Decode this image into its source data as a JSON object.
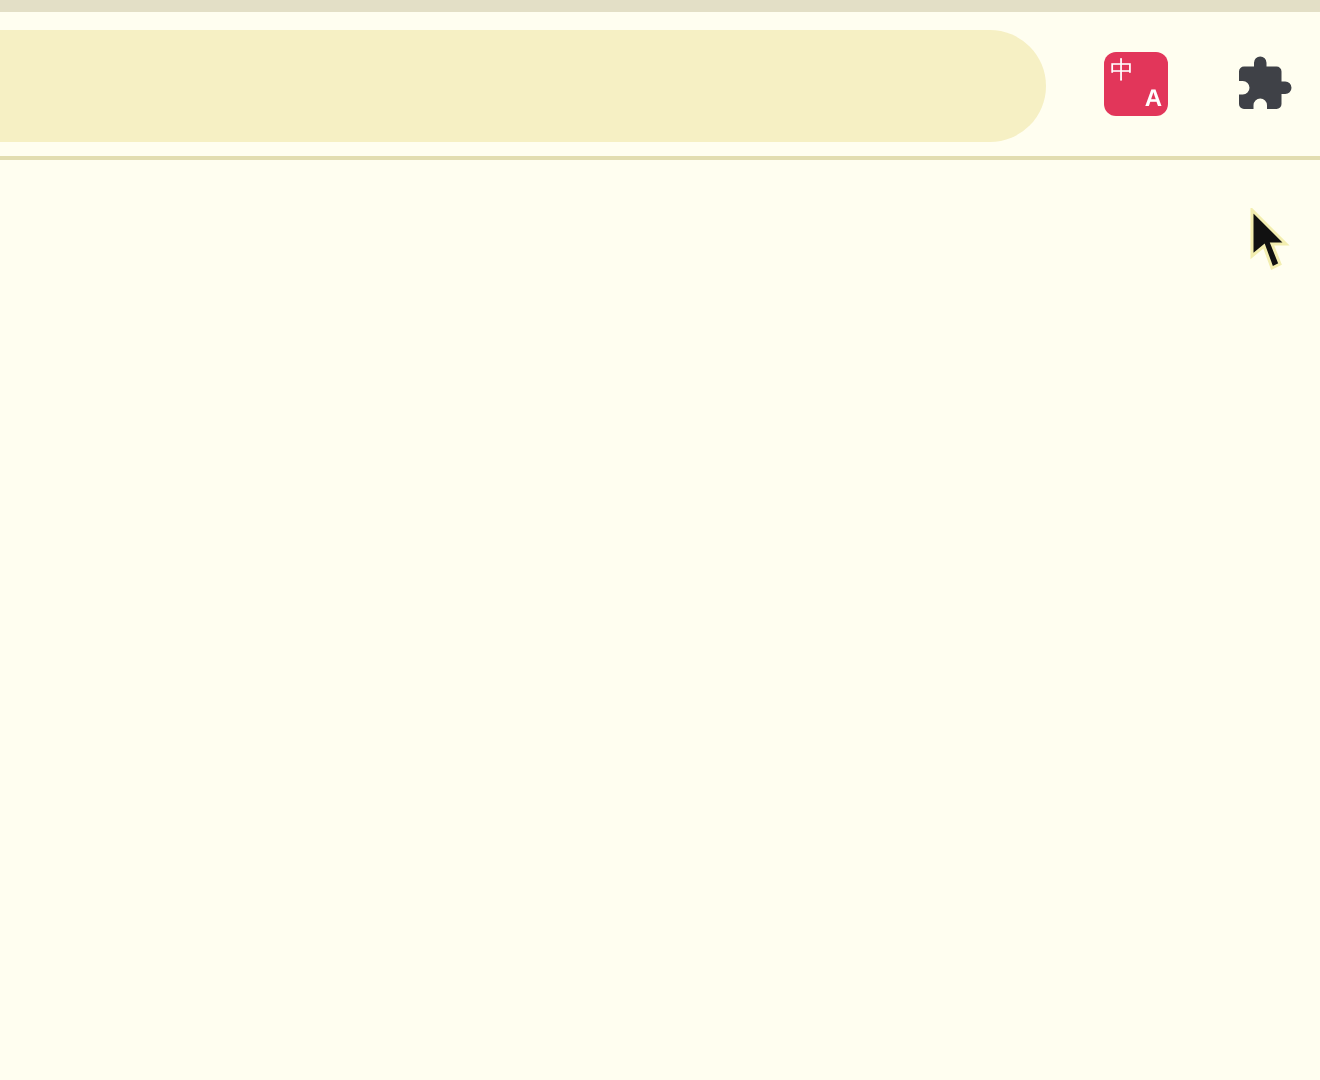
{
  "toolbar": {
    "extensions": [
      {
        "kind": "translate",
        "glyphs": [
          "中",
          "A"
        ]
      },
      {
        "kind": "puzzle"
      }
    ]
  }
}
